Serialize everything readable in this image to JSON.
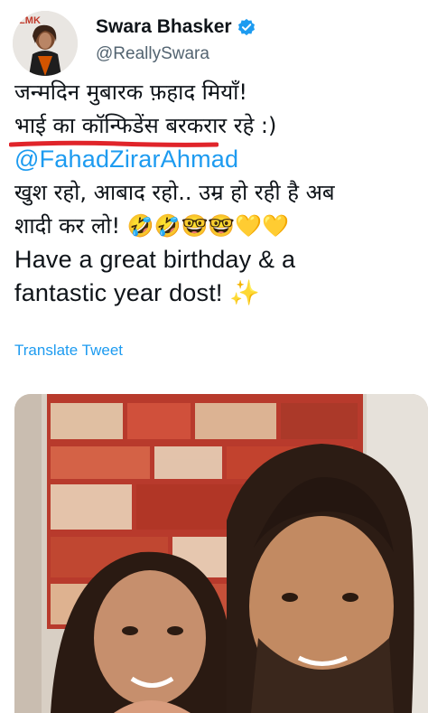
{
  "author": {
    "display_name": "Swara Bhasker",
    "handle": "@ReallySwara",
    "verified": true,
    "avatar_badge_text": "ILMK"
  },
  "tweet": {
    "lines": [
      "जन्मदिन मुबारक फ़हाद मियाँ!",
      "भाई का कॉन्फिडेंस बरकरार रहे :)",
      "@FahadZirarAhmad",
      "खुश रहो, आबाद रहो..  उम्र हो रही है अब",
      "शादी कर लो! 🤣🤣🤓🤓💛💛",
      "Have a great birthday & a",
      "fantastic year dost! ✨"
    ]
  },
  "translate_link": "Translate Tweet",
  "colors": {
    "link_blue": "#1d9bf0",
    "secondary_text": "#536471",
    "underline_red": "#e0242a"
  },
  "icons": [
    "verified-badge-icon"
  ]
}
